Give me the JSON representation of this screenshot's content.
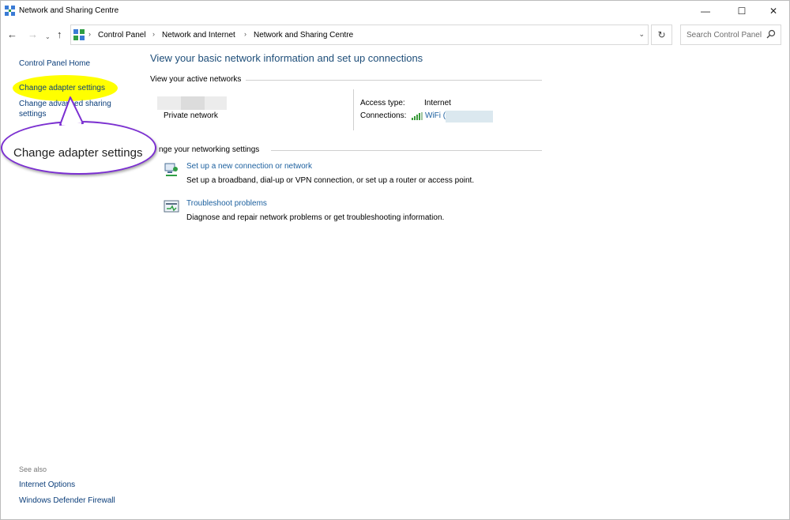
{
  "window": {
    "title": "Network and Sharing Centre"
  },
  "caption": {
    "minimize": "—",
    "maximize": "☐",
    "close": "✕"
  },
  "nav": {
    "back": "←",
    "forward": "→",
    "recent": "⌄",
    "up": "↑"
  },
  "address": {
    "crumbs": [
      "Control Panel",
      "Network and Internet",
      "Network and Sharing Centre"
    ],
    "separator": "›",
    "dropdown": "⌄",
    "refresh": "↻"
  },
  "search": {
    "placeholder": "Search Control Panel"
  },
  "left_pane": {
    "home": "Control Panel Home",
    "adapter": "Change adapter settings",
    "advanced_line1": "Change advanced sharing",
    "advanced_line2": "settings",
    "see_also": "See also",
    "internet_options": "Internet Options",
    "firewall": "Windows Defender Firewall"
  },
  "callout": {
    "text": "Change adapter settings"
  },
  "main": {
    "title": "View your basic network information and set up connections",
    "active_networks_heading": "View your active networks",
    "network_type": "Private network",
    "access_type_label": "Access type:",
    "access_type_value": "Internet",
    "connections_label": "Connections:",
    "connection_link": "WiFi (",
    "change_settings_heading": "nge your networking settings",
    "task1_link": "Set up a new connection or network",
    "task1_desc": "Set up a broadband, dial-up or VPN connection, or set up a router or access point.",
    "task2_link": "Troubleshoot problems",
    "task2_desc": "Diagnose and repair network problems or get troubleshooting information."
  },
  "colors": {
    "link": "#1b5f9e",
    "title": "#1e4e79",
    "highlight": "#ffff00",
    "callout_border": "#7b2fd1"
  }
}
